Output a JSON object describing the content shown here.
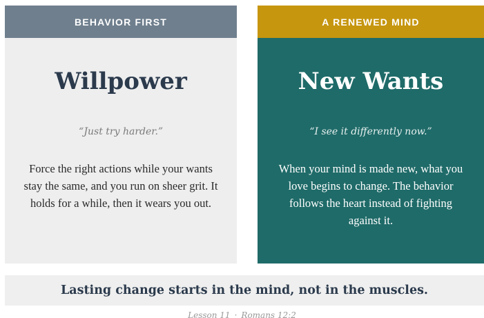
{
  "left_card": {
    "header": "BEHAVIOR FIRST",
    "title": "Willpower",
    "quote": "“Just try harder.”",
    "body": "Force the right actions while your wants stay the same, and you run on sheer grit. It holds for a while, then it wears you out."
  },
  "right_card": {
    "header": "A RENEWED MIND",
    "title": "New Wants",
    "quote": "“I see it differently now.”",
    "body": "When your mind is made new, what you love begins to change. The behavior follows the heart instead of fighting against it."
  },
  "banner": {
    "text": "Lasting change starts in the mind, not in the muscles."
  },
  "footer": {
    "lesson": "Lesson 11",
    "separator": "·",
    "reference": "Romans 12:2"
  },
  "colors": {
    "left_header": "#6f7f8e",
    "left_bg": "#eeeeef",
    "right_header": "#c6960f",
    "right_bg": "#1f6b69",
    "title_dark": "#2b3a4c"
  }
}
